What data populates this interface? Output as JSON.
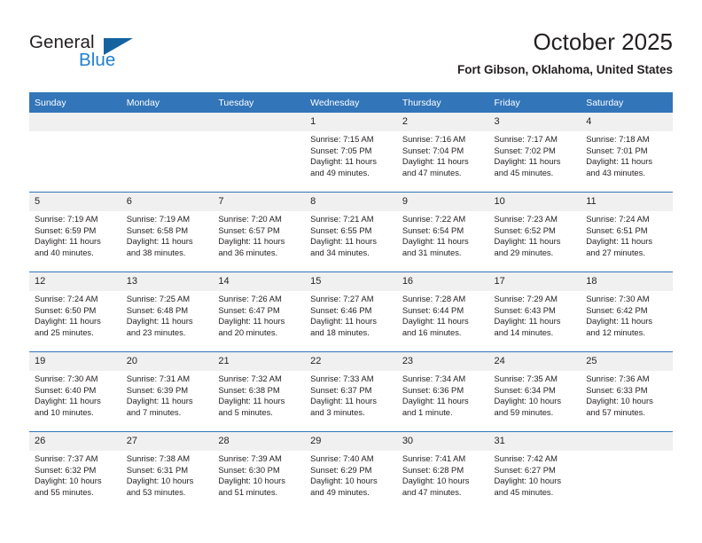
{
  "brand": {
    "name_part1": "General",
    "name_part2": "Blue",
    "logo_icon": "triangle-flag-icon",
    "accent_color": "#1f7fd1",
    "triangle_color": "#15639e"
  },
  "header": {
    "title": "October 2025",
    "location": "Fort Gibson, Oklahoma, United States"
  },
  "calendar": {
    "header_bg": "#3275b9",
    "daynum_bg": "#f0f0f0",
    "weekday_headers": [
      "Sunday",
      "Monday",
      "Tuesday",
      "Wednesday",
      "Thursday",
      "Friday",
      "Saturday"
    ],
    "weeks": [
      [
        {
          "day": "",
          "sunrise": "",
          "sunset": "",
          "daylight_line1": "",
          "daylight_line2": ""
        },
        {
          "day": "",
          "sunrise": "",
          "sunset": "",
          "daylight_line1": "",
          "daylight_line2": ""
        },
        {
          "day": "",
          "sunrise": "",
          "sunset": "",
          "daylight_line1": "",
          "daylight_line2": ""
        },
        {
          "day": "1",
          "sunrise": "Sunrise: 7:15 AM",
          "sunset": "Sunset: 7:05 PM",
          "daylight_line1": "Daylight: 11 hours",
          "daylight_line2": "and 49 minutes."
        },
        {
          "day": "2",
          "sunrise": "Sunrise: 7:16 AM",
          "sunset": "Sunset: 7:04 PM",
          "daylight_line1": "Daylight: 11 hours",
          "daylight_line2": "and 47 minutes."
        },
        {
          "day": "3",
          "sunrise": "Sunrise: 7:17 AM",
          "sunset": "Sunset: 7:02 PM",
          "daylight_line1": "Daylight: 11 hours",
          "daylight_line2": "and 45 minutes."
        },
        {
          "day": "4",
          "sunrise": "Sunrise: 7:18 AM",
          "sunset": "Sunset: 7:01 PM",
          "daylight_line1": "Daylight: 11 hours",
          "daylight_line2": "and 43 minutes."
        }
      ],
      [
        {
          "day": "5",
          "sunrise": "Sunrise: 7:19 AM",
          "sunset": "Sunset: 6:59 PM",
          "daylight_line1": "Daylight: 11 hours",
          "daylight_line2": "and 40 minutes."
        },
        {
          "day": "6",
          "sunrise": "Sunrise: 7:19 AM",
          "sunset": "Sunset: 6:58 PM",
          "daylight_line1": "Daylight: 11 hours",
          "daylight_line2": "and 38 minutes."
        },
        {
          "day": "7",
          "sunrise": "Sunrise: 7:20 AM",
          "sunset": "Sunset: 6:57 PM",
          "daylight_line1": "Daylight: 11 hours",
          "daylight_line2": "and 36 minutes."
        },
        {
          "day": "8",
          "sunrise": "Sunrise: 7:21 AM",
          "sunset": "Sunset: 6:55 PM",
          "daylight_line1": "Daylight: 11 hours",
          "daylight_line2": "and 34 minutes."
        },
        {
          "day": "9",
          "sunrise": "Sunrise: 7:22 AM",
          "sunset": "Sunset: 6:54 PM",
          "daylight_line1": "Daylight: 11 hours",
          "daylight_line2": "and 31 minutes."
        },
        {
          "day": "10",
          "sunrise": "Sunrise: 7:23 AM",
          "sunset": "Sunset: 6:52 PM",
          "daylight_line1": "Daylight: 11 hours",
          "daylight_line2": "and 29 minutes."
        },
        {
          "day": "11",
          "sunrise": "Sunrise: 7:24 AM",
          "sunset": "Sunset: 6:51 PM",
          "daylight_line1": "Daylight: 11 hours",
          "daylight_line2": "and 27 minutes."
        }
      ],
      [
        {
          "day": "12",
          "sunrise": "Sunrise: 7:24 AM",
          "sunset": "Sunset: 6:50 PM",
          "daylight_line1": "Daylight: 11 hours",
          "daylight_line2": "and 25 minutes."
        },
        {
          "day": "13",
          "sunrise": "Sunrise: 7:25 AM",
          "sunset": "Sunset: 6:48 PM",
          "daylight_line1": "Daylight: 11 hours",
          "daylight_line2": "and 23 minutes."
        },
        {
          "day": "14",
          "sunrise": "Sunrise: 7:26 AM",
          "sunset": "Sunset: 6:47 PM",
          "daylight_line1": "Daylight: 11 hours",
          "daylight_line2": "and 20 minutes."
        },
        {
          "day": "15",
          "sunrise": "Sunrise: 7:27 AM",
          "sunset": "Sunset: 6:46 PM",
          "daylight_line1": "Daylight: 11 hours",
          "daylight_line2": "and 18 minutes."
        },
        {
          "day": "16",
          "sunrise": "Sunrise: 7:28 AM",
          "sunset": "Sunset: 6:44 PM",
          "daylight_line1": "Daylight: 11 hours",
          "daylight_line2": "and 16 minutes."
        },
        {
          "day": "17",
          "sunrise": "Sunrise: 7:29 AM",
          "sunset": "Sunset: 6:43 PM",
          "daylight_line1": "Daylight: 11 hours",
          "daylight_line2": "and 14 minutes."
        },
        {
          "day": "18",
          "sunrise": "Sunrise: 7:30 AM",
          "sunset": "Sunset: 6:42 PM",
          "daylight_line1": "Daylight: 11 hours",
          "daylight_line2": "and 12 minutes."
        }
      ],
      [
        {
          "day": "19",
          "sunrise": "Sunrise: 7:30 AM",
          "sunset": "Sunset: 6:40 PM",
          "daylight_line1": "Daylight: 11 hours",
          "daylight_line2": "and 10 minutes."
        },
        {
          "day": "20",
          "sunrise": "Sunrise: 7:31 AM",
          "sunset": "Sunset: 6:39 PM",
          "daylight_line1": "Daylight: 11 hours",
          "daylight_line2": "and 7 minutes."
        },
        {
          "day": "21",
          "sunrise": "Sunrise: 7:32 AM",
          "sunset": "Sunset: 6:38 PM",
          "daylight_line1": "Daylight: 11 hours",
          "daylight_line2": "and 5 minutes."
        },
        {
          "day": "22",
          "sunrise": "Sunrise: 7:33 AM",
          "sunset": "Sunset: 6:37 PM",
          "daylight_line1": "Daylight: 11 hours",
          "daylight_line2": "and 3 minutes."
        },
        {
          "day": "23",
          "sunrise": "Sunrise: 7:34 AM",
          "sunset": "Sunset: 6:36 PM",
          "daylight_line1": "Daylight: 11 hours",
          "daylight_line2": "and 1 minute."
        },
        {
          "day": "24",
          "sunrise": "Sunrise: 7:35 AM",
          "sunset": "Sunset: 6:34 PM",
          "daylight_line1": "Daylight: 10 hours",
          "daylight_line2": "and 59 minutes."
        },
        {
          "day": "25",
          "sunrise": "Sunrise: 7:36 AM",
          "sunset": "Sunset: 6:33 PM",
          "daylight_line1": "Daylight: 10 hours",
          "daylight_line2": "and 57 minutes."
        }
      ],
      [
        {
          "day": "26",
          "sunrise": "Sunrise: 7:37 AM",
          "sunset": "Sunset: 6:32 PM",
          "daylight_line1": "Daylight: 10 hours",
          "daylight_line2": "and 55 minutes."
        },
        {
          "day": "27",
          "sunrise": "Sunrise: 7:38 AM",
          "sunset": "Sunset: 6:31 PM",
          "daylight_line1": "Daylight: 10 hours",
          "daylight_line2": "and 53 minutes."
        },
        {
          "day": "28",
          "sunrise": "Sunrise: 7:39 AM",
          "sunset": "Sunset: 6:30 PM",
          "daylight_line1": "Daylight: 10 hours",
          "daylight_line2": "and 51 minutes."
        },
        {
          "day": "29",
          "sunrise": "Sunrise: 7:40 AM",
          "sunset": "Sunset: 6:29 PM",
          "daylight_line1": "Daylight: 10 hours",
          "daylight_line2": "and 49 minutes."
        },
        {
          "day": "30",
          "sunrise": "Sunrise: 7:41 AM",
          "sunset": "Sunset: 6:28 PM",
          "daylight_line1": "Daylight: 10 hours",
          "daylight_line2": "and 47 minutes."
        },
        {
          "day": "31",
          "sunrise": "Sunrise: 7:42 AM",
          "sunset": "Sunset: 6:27 PM",
          "daylight_line1": "Daylight: 10 hours",
          "daylight_line2": "and 45 minutes."
        },
        {
          "day": "",
          "sunrise": "",
          "sunset": "",
          "daylight_line1": "",
          "daylight_line2": ""
        }
      ]
    ]
  }
}
